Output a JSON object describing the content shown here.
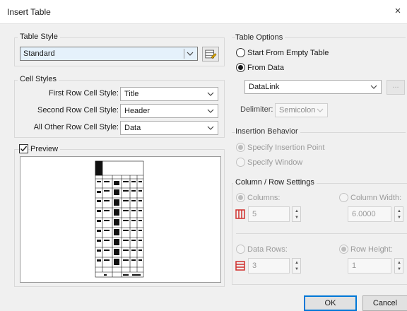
{
  "dialog": {
    "title": "Insert Table",
    "close_symbol": "×"
  },
  "table_style": {
    "group_label": "Table Style",
    "selected": "Standard"
  },
  "cell_styles": {
    "group_label": "Cell Styles",
    "first_row_label": "First Row Cell Style:",
    "first_row_value": "Title",
    "second_row_label": "Second Row Cell Style:",
    "second_row_value": "Header",
    "other_rows_label": "All Other Row Cell Style:",
    "other_rows_value": "Data"
  },
  "preview": {
    "label": "Preview",
    "checked": true
  },
  "table_options": {
    "group_label": "Table Options",
    "start_empty_label": "Start From Empty Table",
    "from_data_label": "From Data",
    "datalink_value": "DataLink",
    "browse_label": "...",
    "delimiter_label": "Delimiter:",
    "delimiter_value": "Semicolon"
  },
  "insertion": {
    "group_label": "Insertion Behavior",
    "specify_point_label": "Specify Insertion Point",
    "specify_window_label": "Specify Window"
  },
  "col_row": {
    "group_label": "Column / Row Settings",
    "columns_label": "Columns:",
    "columns_value": "5",
    "column_width_label": "Column Width:",
    "column_width_value": "6.0000",
    "data_rows_label": "Data Rows:",
    "data_rows_value": "3",
    "row_height_label": "Row Height:",
    "row_height_value": "1"
  },
  "buttons": {
    "ok": "OK",
    "cancel": "Cancel"
  },
  "colors": {
    "accent": "#0078d7",
    "icon_red": "#d0312d",
    "selection": "#e5f1fb"
  }
}
